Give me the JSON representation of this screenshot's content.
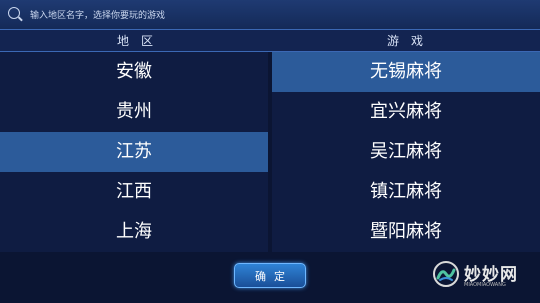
{
  "search": {
    "placeholder": "输入地区名字，选择你要玩的游戏",
    "icon": "search-icon"
  },
  "headers": {
    "region": "地区",
    "game": "游戏"
  },
  "regions": [
    {
      "label": "安徽",
      "selected": false
    },
    {
      "label": "贵州",
      "selected": false
    },
    {
      "label": "江苏",
      "selected": true
    },
    {
      "label": "江西",
      "selected": false
    },
    {
      "label": "上海",
      "selected": false
    }
  ],
  "games": [
    {
      "label": "无锡麻将",
      "selected": true
    },
    {
      "label": "宜兴麻将",
      "selected": false
    },
    {
      "label": "吴江麻将",
      "selected": false
    },
    {
      "label": "镇江麻将",
      "selected": false
    },
    {
      "label": "暨阳麻将",
      "selected": false
    }
  ],
  "confirm": {
    "label": "确定"
  },
  "watermark": {
    "title": "妙妙网",
    "subtitle": "MIAOMIAOWANG"
  },
  "colors": {
    "background": "#0d1839",
    "selected_row": "#2c5b9a",
    "accent": "#3b68b4"
  }
}
